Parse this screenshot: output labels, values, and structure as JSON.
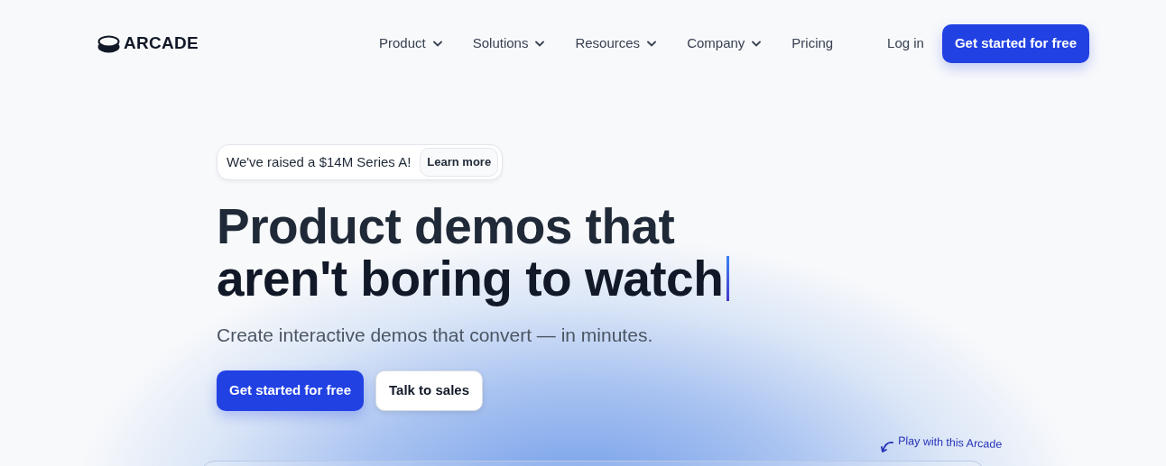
{
  "brand": {
    "name": "ARCADE"
  },
  "nav": [
    {
      "label": "Product",
      "dropdown": true
    },
    {
      "label": "Solutions",
      "dropdown": true
    },
    {
      "label": "Resources",
      "dropdown": true
    },
    {
      "label": "Company",
      "dropdown": true
    },
    {
      "label": "Pricing",
      "dropdown": false
    }
  ],
  "login": "Log in",
  "header_cta": "Get started for free",
  "announcement": {
    "text": "We've raised a $14M Series A!",
    "link": "Learn more"
  },
  "headline": [
    "Product demos that",
    "aren't boring to watch"
  ],
  "subheadline": "Create interactive demos that convert — in minutes.",
  "buttons": [
    {
      "label": "Get started for free",
      "kind": "primary"
    },
    {
      "label": "Talk to sales",
      "kind": "secondary"
    }
  ],
  "demo_hint": "Play with this Arcade"
}
